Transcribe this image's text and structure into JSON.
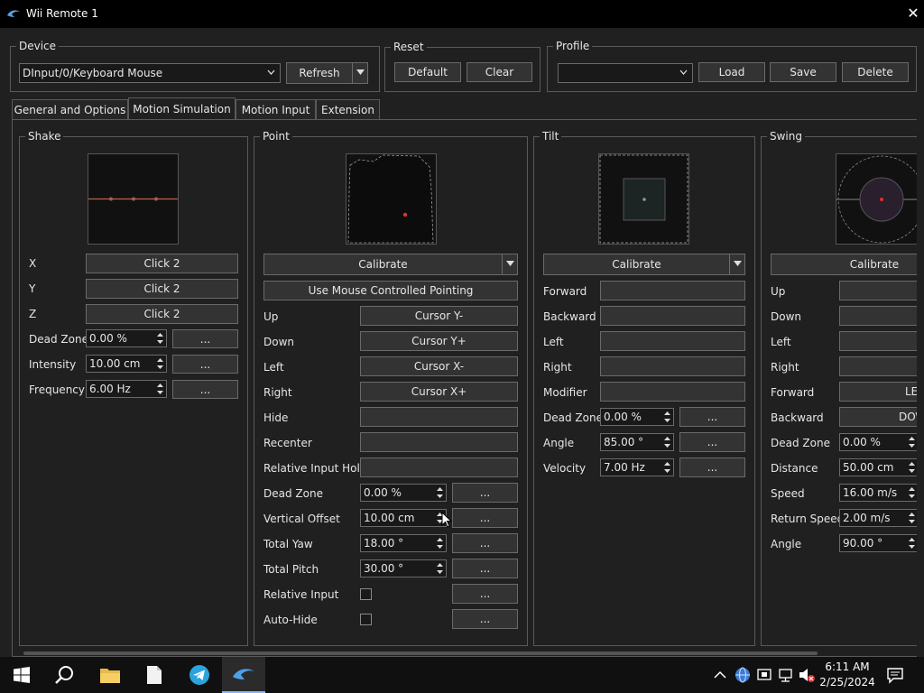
{
  "window": {
    "title": "Wii Remote 1"
  },
  "device": {
    "legend": "Device",
    "selected": "DInput/0/Keyboard Mouse",
    "refresh_label": "Refresh"
  },
  "reset": {
    "legend": "Reset",
    "default_label": "Default",
    "clear_label": "Clear"
  },
  "profile": {
    "legend": "Profile",
    "selected": "",
    "load_label": "Load",
    "save_label": "Save",
    "delete_label": "Delete"
  },
  "tabs": [
    {
      "label": "General and Options"
    },
    {
      "label": "Motion Simulation"
    },
    {
      "label": "Motion Input"
    },
    {
      "label": "Extension"
    }
  ],
  "shake": {
    "legend": "Shake",
    "x_label": "X",
    "x_value": "Click 2",
    "y_label": "Y",
    "y_value": "Click 2",
    "z_label": "Z",
    "z_value": "Click 2",
    "deadzone_label": "Dead Zone",
    "deadzone_value": "0.00 %",
    "intensity_label": "Intensity",
    "intensity_value": "10.00 cm",
    "frequency_label": "Frequency",
    "frequency_value": "6.00 Hz",
    "more": "..."
  },
  "point": {
    "legend": "Point",
    "calibrate_label": "Calibrate",
    "mouse_label": "Use Mouse Controlled Pointing",
    "up_label": "Up",
    "up_value": "Cursor Y-",
    "down_label": "Down",
    "down_value": "Cursor Y+",
    "left_label": "Left",
    "left_value": "Cursor X-",
    "right_label": "Right",
    "right_value": "Cursor X+",
    "hide_label": "Hide",
    "hide_value": "",
    "recenter_label": "Recenter",
    "recenter_value": "",
    "relhold_label": "Relative Input Hold",
    "relhold_value": "",
    "deadzone_label": "Dead Zone",
    "deadzone_value": "0.00 %",
    "voffset_label": "Vertical Offset",
    "voffset_value": "10.00 cm",
    "yaw_label": "Total Yaw",
    "yaw_value": "18.00 °",
    "pitch_label": "Total Pitch",
    "pitch_value": "30.00 °",
    "relinput_label": "Relative Input",
    "autohide_label": "Auto-Hide",
    "more": "..."
  },
  "tilt": {
    "legend": "Tilt",
    "calibrate_label": "Calibrate",
    "forward_label": "Forward",
    "forward_value": "",
    "backward_label": "Backward",
    "backward_value": "",
    "left_label": "Left",
    "left_value": "",
    "right_label": "Right",
    "right_value": "",
    "modifier_label": "Modifier",
    "modifier_value": "",
    "deadzone_label": "Dead Zone",
    "deadzone_value": "0.00 %",
    "angle_label": "Angle",
    "angle_value": "85.00 °",
    "velocity_label": "Velocity",
    "velocity_value": "7.00 Hz",
    "more": "..."
  },
  "swing": {
    "legend": "Swing",
    "calibrate_label": "Calibrate",
    "up_label": "Up",
    "up_value": "",
    "down_label": "Down",
    "down_value": "",
    "left_label": "Left",
    "left_value": "",
    "right_label": "Right",
    "right_value": "",
    "forward_label": "Forward",
    "forward_value": "LE",
    "backward_label": "Backward",
    "backward_value": "DO\\",
    "deadzone_label": "Dead Zone",
    "deadzone_value": "0.00 %",
    "distance_label": "Distance",
    "distance_value": "50.00 cm",
    "speed_label": "Speed",
    "speed_value": "16.00 m/s",
    "return_label": "Return Speed",
    "return_value": "2.00 m/s",
    "angle_label": "Angle",
    "angle_value": "90.00 °"
  },
  "taskbar": {
    "time": "6:11 AM",
    "date": "2/25/2024"
  },
  "colors": {
    "accent": "#8ab4f8",
    "indicator": "#e03030",
    "shake_line": "#c0604a"
  }
}
